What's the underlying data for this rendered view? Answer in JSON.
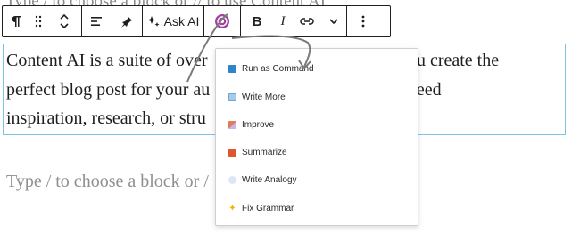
{
  "editor": {
    "background_text": "Type / to choose a block or // to use Content AI",
    "paragraph_lines": [
      "Content AI is a suite of over                                   help you create the",
      "perfect blog post for your au                                   r you need",
      "inspiration, research, or stru                                  for you."
    ],
    "placeholder": "Type / to choose a block or /"
  },
  "toolbar": {
    "ask_ai_label": "Ask AI",
    "bold_label": "B",
    "italic_label": "I",
    "icons": [
      "paragraph-icon",
      "drag-handle-icon",
      "move-up-down-icon",
      "align-icon",
      "pin-icon",
      "sparkle-icon",
      "content-ai-icon",
      "link-icon",
      "chevron-down-icon",
      "more-options-icon"
    ]
  },
  "menu": {
    "items": [
      {
        "label": "Run as Command",
        "icon": "command-icon",
        "color": "#2f83c7"
      },
      {
        "label": "Write More",
        "icon": "book-icon",
        "color": "#6aa7d8"
      },
      {
        "label": "Improve",
        "icon": "brush-icon",
        "color": "#e07b5c"
      },
      {
        "label": "Summarize",
        "icon": "summary-icon",
        "color": "#e0552c"
      },
      {
        "label": "Write Analogy",
        "icon": "thought-icon",
        "color": "#b8c8e8"
      },
      {
        "label": "Fix Grammar",
        "icon": "sparkles-icon",
        "color": "#f0b400"
      }
    ]
  },
  "colors": {
    "accent": "#7ec3e6",
    "content_ai_purple": "#a23fa3"
  }
}
